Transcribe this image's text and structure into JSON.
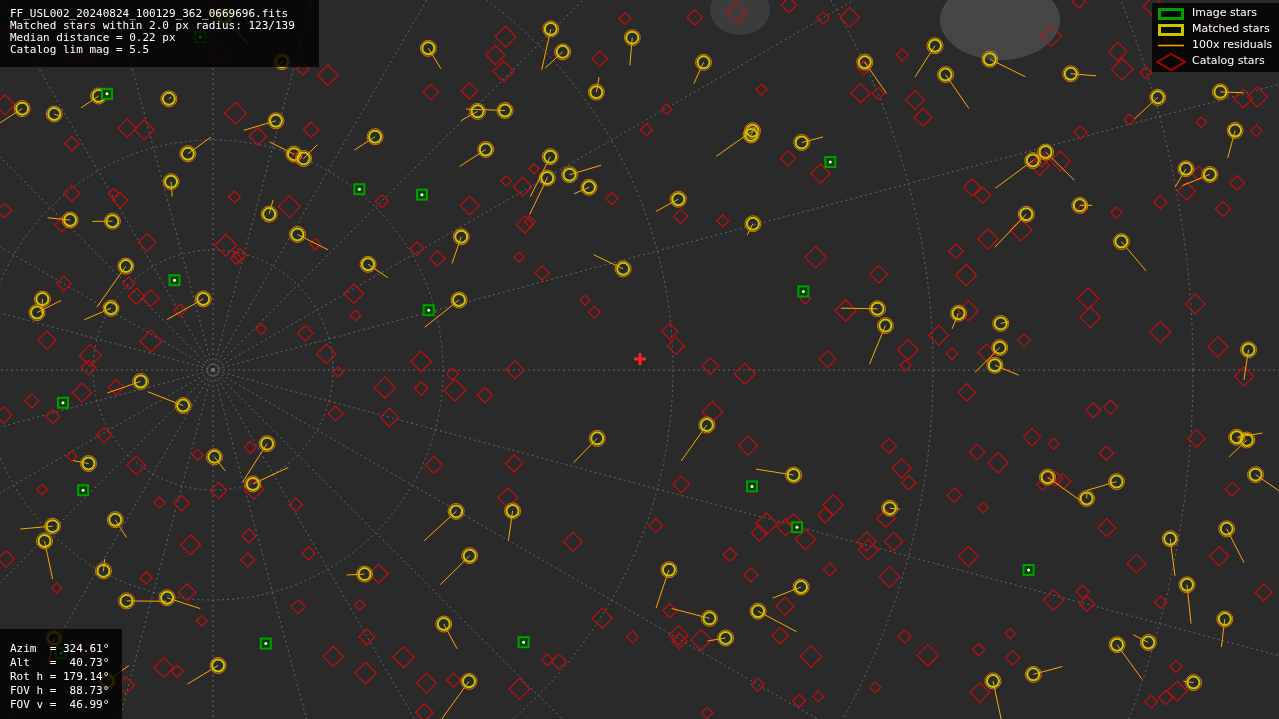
{
  "info": {
    "lines": [
      "FF_USL002_20240824_100129_362_0669696.fits",
      "Matched stars within 2.0 px radius: 123/139",
      "Median distance = 0.22 px",
      "Catalog lim mag = 5.5"
    ]
  },
  "legend": [
    {
      "kind": "image",
      "label": "Image stars",
      "color": "#00a000"
    },
    {
      "kind": "matched",
      "label": "Matched stars",
      "color": "#c8c800"
    },
    {
      "kind": "residual",
      "label": "100x residuals",
      "color": "#ffa500"
    },
    {
      "kind": "catalog",
      "label": "Catalog stars",
      "color": "#b00000"
    }
  ],
  "pointing": {
    "lines": [
      "Azim  = 324.61°",
      "Alt   =  40.73°",
      "Rot h = 179.14°",
      "FOV h =  88.73°",
      "FOV v =  46.99°"
    ]
  }
}
